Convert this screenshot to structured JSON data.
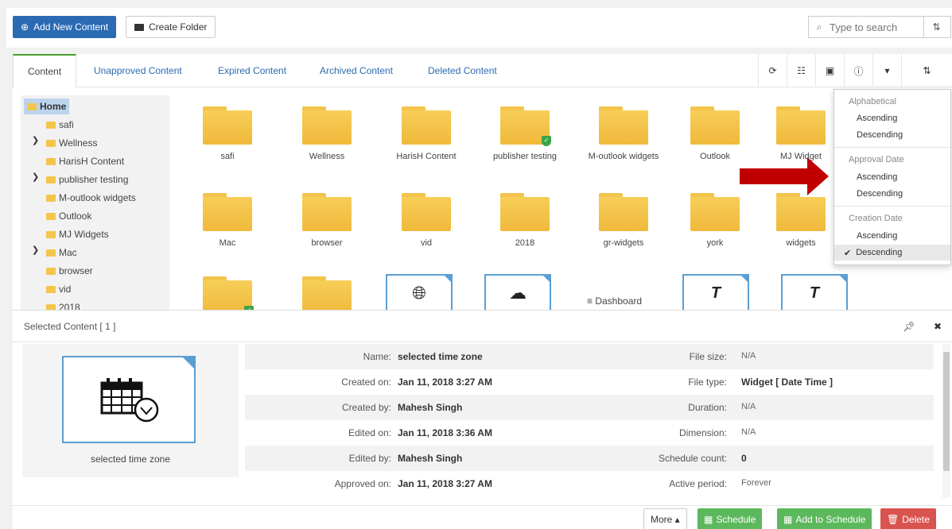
{
  "toolbar": {
    "add_new": "Add New Content",
    "create_folder": "Create Folder",
    "search_placeholder": "Type to search"
  },
  "tabs": [
    "Content",
    "Unapproved Content",
    "Expired Content",
    "Archived Content",
    "Deleted Content"
  ],
  "tree": {
    "items": [
      "Home",
      "safi",
      "Wellness",
      "HarisH Content",
      "publisher testing",
      "M-outlook widgets",
      "Outlook",
      "MJ Widgets",
      "Mac",
      "browser",
      "vid",
      "2018"
    ]
  },
  "grid": {
    "row1": [
      "safi",
      "Wellness",
      "HarisH Content",
      "publisher testing",
      "M-outlook widgets",
      "Outlook",
      "MJ Widget"
    ],
    "row2": [
      "Mac",
      "browser",
      "vid",
      "2018",
      "gr-widgets",
      "york",
      "widgets"
    ],
    "dashboard_label": "≡ Dashboard"
  },
  "sort_menu": {
    "groups": [
      {
        "title": "Alphabetical",
        "asc": "Ascending",
        "desc": "Descending"
      },
      {
        "title": "Approval Date",
        "asc": "Ascending",
        "desc": "Descending"
      },
      {
        "title": "Creation Date",
        "asc": "Ascending",
        "desc": "Descending"
      }
    ],
    "check": "✔"
  },
  "selected": {
    "title": "Selected Content [ 1 ]",
    "preview_label": "selected time zone",
    "rows": [
      {
        "l1": "Name:",
        "v1": "selected time zone",
        "l2": "File size:",
        "v2": "N/A"
      },
      {
        "l1": "Created on:",
        "v1": "Jan 11, 2018 3:27 AM",
        "l2": "File type:",
        "v2": "Widget [ Date Time ]"
      },
      {
        "l1": "Created by:",
        "v1": "Mahesh Singh",
        "l2": "Duration:",
        "v2": "N/A"
      },
      {
        "l1": "Edited on:",
        "v1": "Jan 11, 2018 3:36 AM",
        "l2": "Dimension:",
        "v2": "N/A"
      },
      {
        "l1": "Edited by:",
        "v1": "Mahesh Singh",
        "l2": "Schedule count:",
        "v2": "0"
      },
      {
        "l1": "Approved on:",
        "v1": "Jan 11, 2018 3:27 AM",
        "l2": "Active period:",
        "v2": "Forever"
      }
    ]
  },
  "actions": {
    "more": "More ▴",
    "schedule": "Schedule",
    "add_to_schedule": "Add to Schedule",
    "delete": "Delete"
  },
  "colors": {
    "primary": "#2a6bb3",
    "success": "#5cb85c",
    "danger": "#d9534f",
    "folder": "#f4c54b",
    "arrow": "#c00000"
  }
}
